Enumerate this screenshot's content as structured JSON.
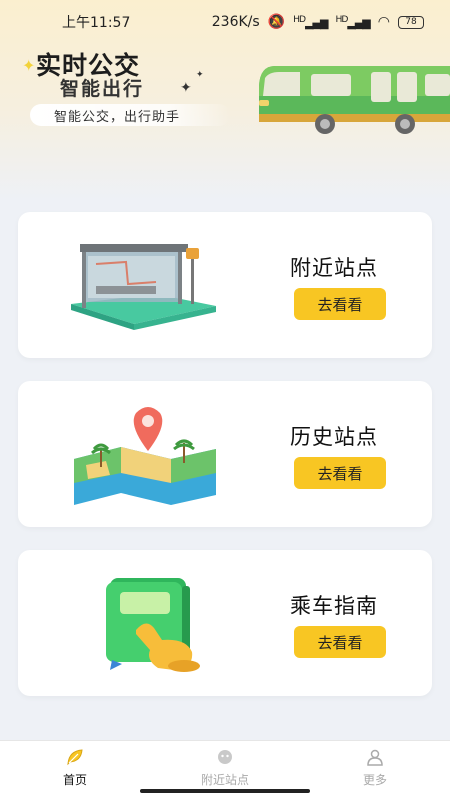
{
  "status_bar": {
    "time": "上午11:57",
    "net_speed": "236K/s",
    "signal1": "HD",
    "signal2": "HD",
    "battery": "78"
  },
  "banner": {
    "title": "实时公交",
    "subtitle": "智能出行",
    "slogan": "智能公交，出行助手"
  },
  "cards": [
    {
      "title": "附近站点",
      "button": "去看看",
      "icon": "bus-stop-illustration"
    },
    {
      "title": "历史站点",
      "button": "去看看",
      "icon": "map-pin-illustration"
    },
    {
      "title": "乘车指南",
      "button": "去看看",
      "icon": "guide-book-illustration"
    }
  ],
  "tabbar": {
    "items": [
      {
        "label": "首页",
        "icon": "leaf-icon",
        "active": true
      },
      {
        "label": "附近站点",
        "icon": "stop-icon",
        "active": false
      },
      {
        "label": "更多",
        "icon": "person-icon",
        "active": false
      }
    ]
  },
  "colors": {
    "accent": "#f8c623",
    "background": "#eef1f6",
    "train": "#4caf50"
  }
}
